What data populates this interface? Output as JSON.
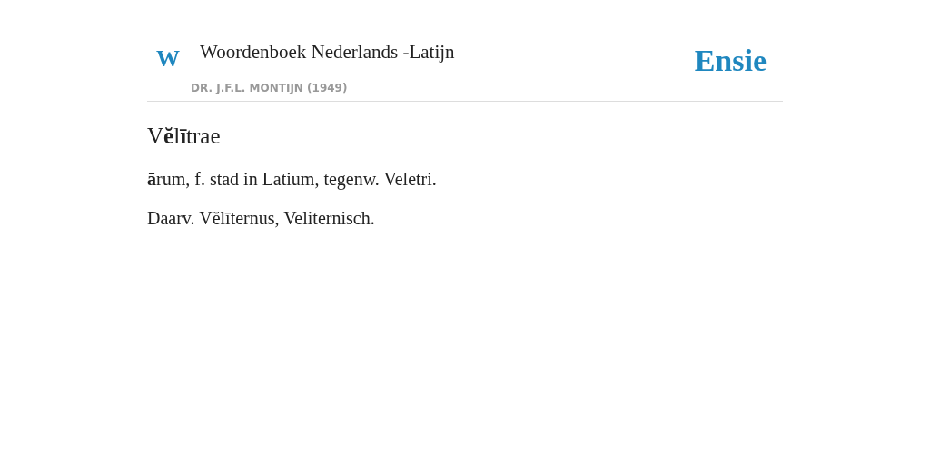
{
  "header": {
    "logo_letter": "W",
    "title": "Woordenboek Nederlands -Latijn",
    "author": "DR. J.F.L. MONTIJN (1949)",
    "brand": "Ensie"
  },
  "entry": {
    "headword": "V**ĕ**l**ī**trae",
    "paragraphs": [
      "**ā**rum, f. stad in Latium, tegenw. Veletri.",
      "Daarv. Vĕlīternus, Veliternisch."
    ]
  }
}
